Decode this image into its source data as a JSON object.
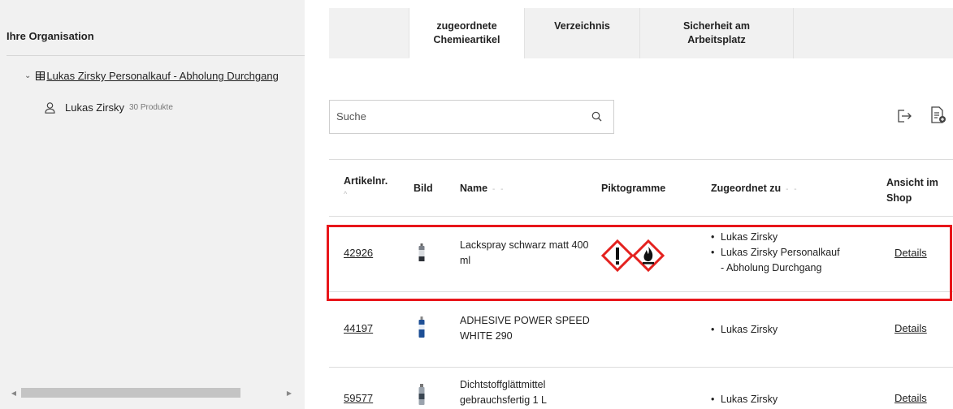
{
  "sidebar": {
    "title": "Ihre Organisation",
    "tree": {
      "root_label": "Lukas Zirsky Personalkauf - Abholung Durchgang",
      "child_name": "Lukas Zirsky",
      "child_count": "30 Produkte"
    }
  },
  "tabs": [
    {
      "label": "",
      "active": false
    },
    {
      "label": "zugeordnete Chemieartikel",
      "active": true
    },
    {
      "label": "Verzeichnis",
      "active": false
    },
    {
      "label": "Sicherheit am Arbeitsplatz",
      "active": false
    },
    {
      "label": "",
      "active": false
    }
  ],
  "search": {
    "placeholder": "Suche",
    "value": ""
  },
  "toolbar": {
    "export_icon": "export-icon",
    "pdf_icon": "pdf-list-icon"
  },
  "table": {
    "headers": {
      "artnr": "Artikelnr.",
      "bild": "Bild",
      "name": "Name",
      "pikto": "Piktogramme",
      "zugeordnet": "Zugeordnet zu",
      "ansicht": "Ansicht im Shop"
    },
    "rows": [
      {
        "artnr": "42926",
        "name": "Lackspray schwarz matt 400 ml",
        "pictograms": [
          "ghs-exclamation",
          "ghs-flame"
        ],
        "assigned": [
          "Lukas Zirsky",
          "Lukas Zirsky Personalkauf - Abholung Durchgang"
        ],
        "details": "Details"
      },
      {
        "artnr": "44197",
        "name": "ADHESIVE POWER SPEED WHITE 290",
        "pictograms": [],
        "assigned": [
          "Lukas Zirsky"
        ],
        "details": "Details"
      },
      {
        "artnr": "59577",
        "name": "Dichtstoffglättmittel gebrauchsfertig 1 L",
        "pictograms": [],
        "assigned": [
          "Lukas Zirsky"
        ],
        "details": "Details"
      }
    ]
  },
  "colors": {
    "highlight": "#e8161b",
    "ghs_red": "#e4221f",
    "panel_bg": "#f1f1f1"
  }
}
